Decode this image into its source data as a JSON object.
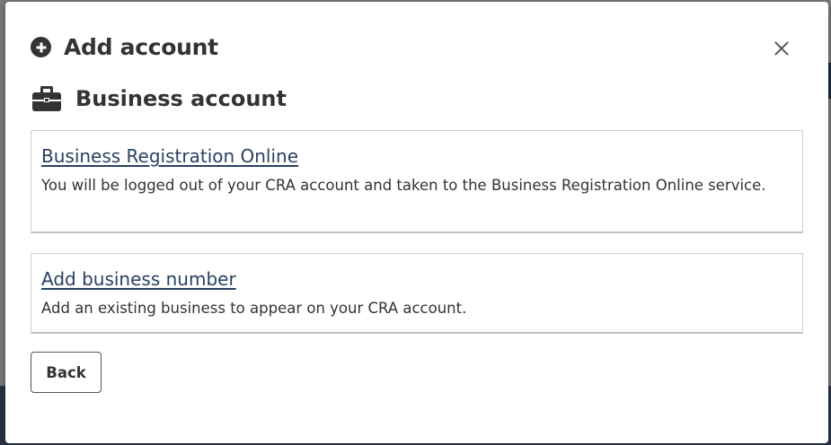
{
  "modal": {
    "title": "Add account",
    "close_icon": "close-icon",
    "header_icon": "plus-circle-icon"
  },
  "section": {
    "title": "Business account",
    "icon": "briefcase-icon"
  },
  "options": [
    {
      "link_label": "Business Registration Online",
      "description": "You will be logged out of your CRA account and taken to the Business Registration Online service."
    },
    {
      "link_label": "Add business number",
      "description": "Add an existing business to appear on your CRA account."
    }
  ],
  "footer": {
    "back_label": "Back"
  },
  "colors": {
    "link": "#284162",
    "text": "#333333",
    "overlay": "#6b6b6b"
  }
}
